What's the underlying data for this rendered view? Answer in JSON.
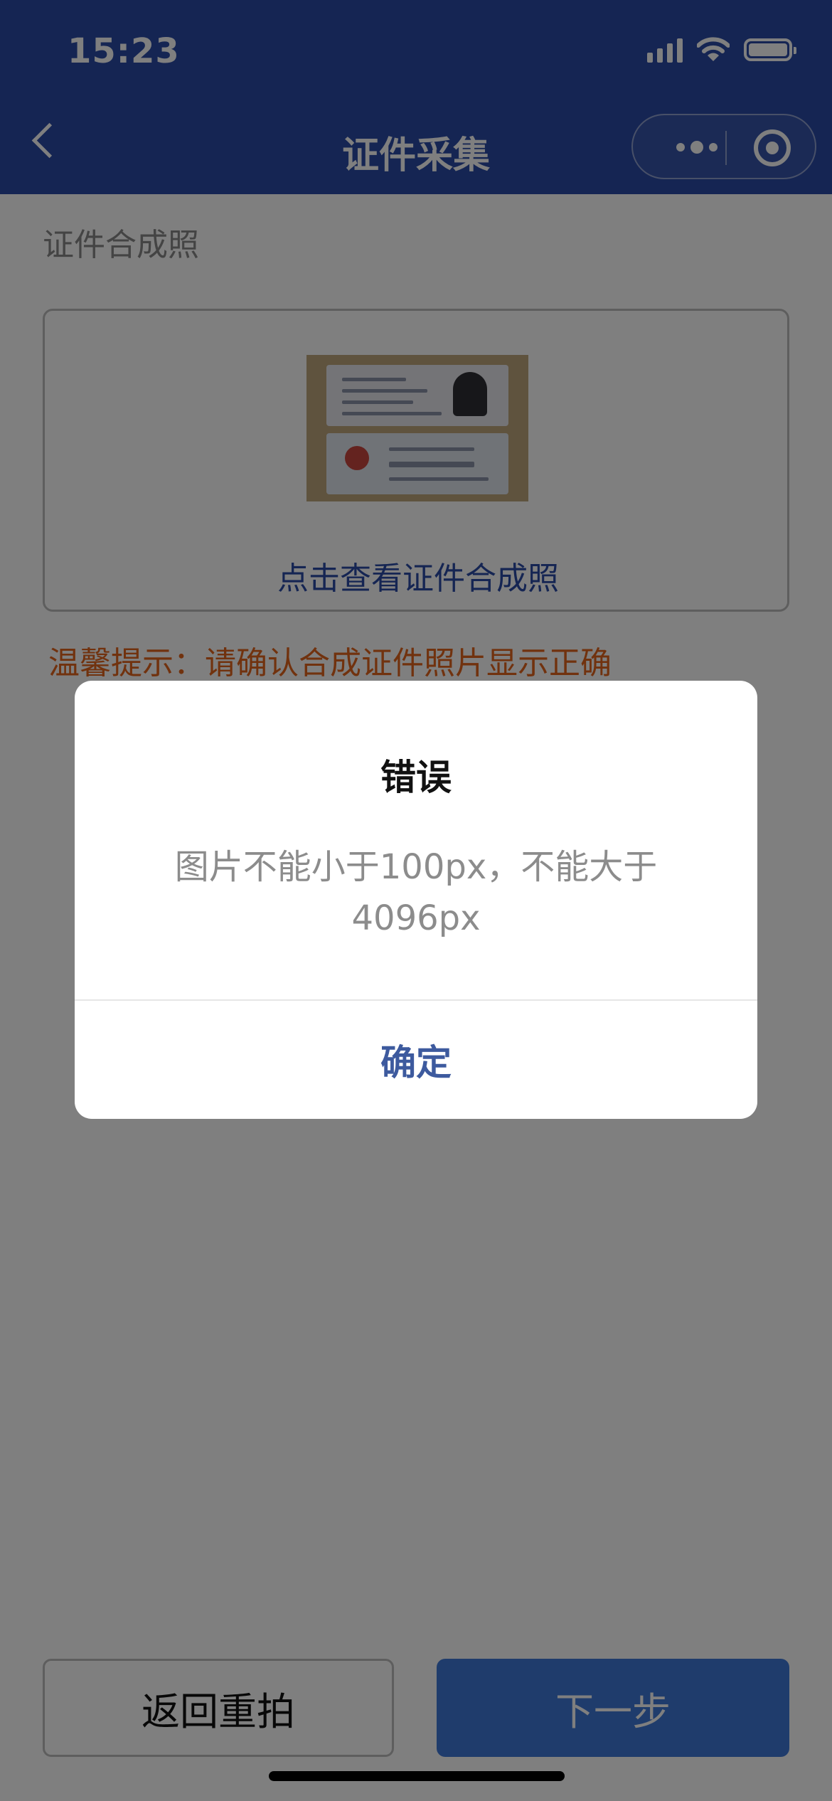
{
  "status_bar": {
    "time": "15:23"
  },
  "nav": {
    "title": "证件采集"
  },
  "content": {
    "section_label": "证件合成照",
    "photo_link": "点击查看证件合成照",
    "tip": "温馨提示：请确认合成证件照片显示正确"
  },
  "buttons": {
    "retake": "返回重拍",
    "next": "下一步"
  },
  "dialog": {
    "title": "错误",
    "message": "图片不能小于100px，不能大于4096px",
    "confirm": "确定"
  },
  "colors": {
    "header": "#2b4ba6",
    "tip": "#e2641c",
    "primary_button": "#3f79d9",
    "dialog_confirm": "#3d5a9e"
  },
  "icons": [
    "back-arrow-icon",
    "more-dots-icon",
    "close-target-icon",
    "signal-icon",
    "wifi-icon",
    "battery-icon"
  ]
}
